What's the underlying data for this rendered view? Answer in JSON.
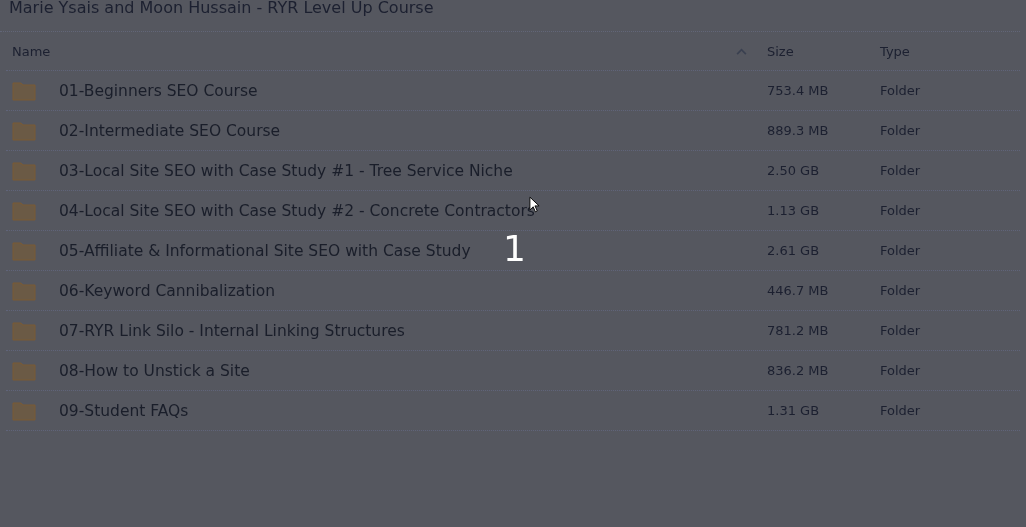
{
  "title": "Marie Ysais and Moon Hussain - RYR Level Up Course",
  "table": {
    "columns": [
      {
        "label": "Name",
        "sorted": true
      },
      {
        "label": "Size",
        "sorted": false
      },
      {
        "label": "Type",
        "sorted": false
      }
    ],
    "rows": [
      {
        "name": "01-Beginners SEO Course",
        "size": "753.4 MB",
        "type": "Folder"
      },
      {
        "name": "02-Intermediate SEO Course",
        "size": "889.3 MB",
        "type": "Folder"
      },
      {
        "name": "03-Local Site SEO with Case Study #1 - Tree Service Niche",
        "size": "2.50 GB",
        "type": "Folder"
      },
      {
        "name": "04-Local Site SEO with Case Study #2 - Concrete Contractors",
        "size": "1.13 GB",
        "type": "Folder"
      },
      {
        "name": "05-Affiliate & Informational Site SEO with Case Study",
        "size": "2.61 GB",
        "type": "Folder"
      },
      {
        "name": "06-Keyword Cannibalization",
        "size": "446.7 MB",
        "type": "Folder"
      },
      {
        "name": "07-RYR Link Silo - Internal Linking Structures",
        "size": "781.2 MB",
        "type": "Folder"
      },
      {
        "name": "08-How to Unstick a Site",
        "size": "836.2 MB",
        "type": "Folder"
      },
      {
        "name": "09-Student FAQs",
        "size": "1.31 GB",
        "type": "Folder"
      }
    ]
  },
  "countdown": "1"
}
